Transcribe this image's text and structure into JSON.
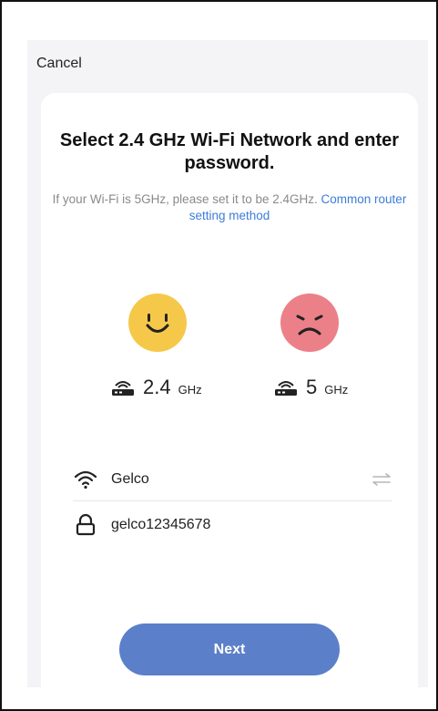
{
  "header": {
    "cancel_label": "Cancel"
  },
  "card": {
    "title": "Select 2.4 GHz Wi-Fi Network and enter password.",
    "subtitle_text": "If your Wi-Fi is 5GHz, please set it to be 2.4GHz.",
    "subtitle_link": "Common router setting method"
  },
  "bands": [
    {
      "num": "2.4",
      "unit": "GHz",
      "face": "happy-face-icon",
      "color": "#f6c84a"
    },
    {
      "num": "5",
      "unit": "GHz",
      "face": "sad-face-icon",
      "color": "#ec8088"
    }
  ],
  "network": {
    "ssid": "Gelco",
    "password": "gelco12345678"
  },
  "actions": {
    "next_label": "Next"
  },
  "colors": {
    "accent": "#5b7fc9",
    "link": "#3b7dd8"
  }
}
